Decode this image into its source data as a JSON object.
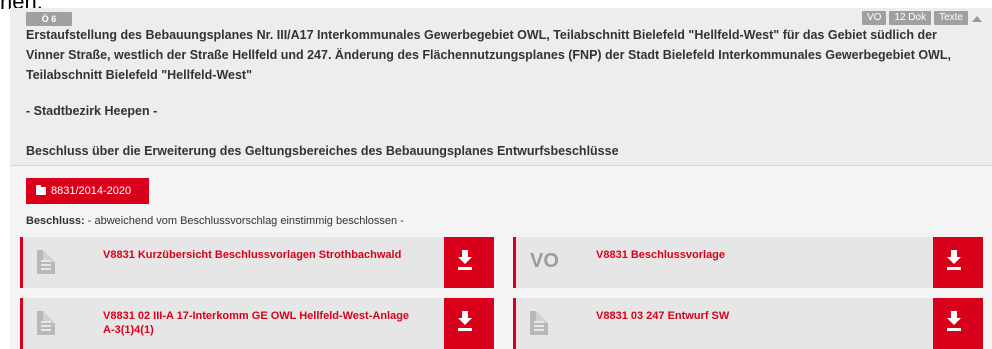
{
  "top_cutoff_text": "nen.",
  "agenda_item": {
    "number": "Ö 6",
    "tags": [
      "VO",
      "12 Dok",
      "Texte"
    ],
    "title": "Erstaufstellung des Bebauungsplanes Nr. III/A17 Interkommunales Gewerbegebiet OWL, Teilabschnitt Bielefeld \"Hellfeld-West\" für das Gebiet südlich der Vinner Straße, westlich der Straße Hellfeld und 247. Änderung des Flächennutzungsplanes (FNP) der Stadt Bielefeld Interkommunales Gewerbegebiet OWL, Teilabschnitt Bielefeld \"Hellfeld-West\"",
    "district": "- Stadtbezirk Heepen -",
    "resolution_subject": "Beschluss über die Erweiterung des Geltungsbereiches des Bebauungsplanes Entwurfsbeschlüsse",
    "reference_button": "8831/2014-2020",
    "decision_label": "Beschluss:",
    "decision_text": "- abweichend vom Beschlussvorschlag einstimmig beschlossen -",
    "documents": [
      {
        "title": "V8831 Kurzübersicht Beschlussvorlagen Strothbachwald",
        "icon": "document-icon"
      },
      {
        "title": "V8831 Beschlussvorlage",
        "icon": "vo-label",
        "icon_text": "VO"
      },
      {
        "title": "V8831 02 III-A 17-Interkomm GE OWL Hellfeld-West-Anlage A-3(1)4(1)",
        "icon": "document-icon"
      },
      {
        "title": "V8831 03 247 Entwurf SW",
        "icon": "document-icon"
      }
    ]
  },
  "colors": {
    "accent": "#d9001b",
    "badge": "#a0a0a0",
    "header_bg": "#ededed"
  }
}
